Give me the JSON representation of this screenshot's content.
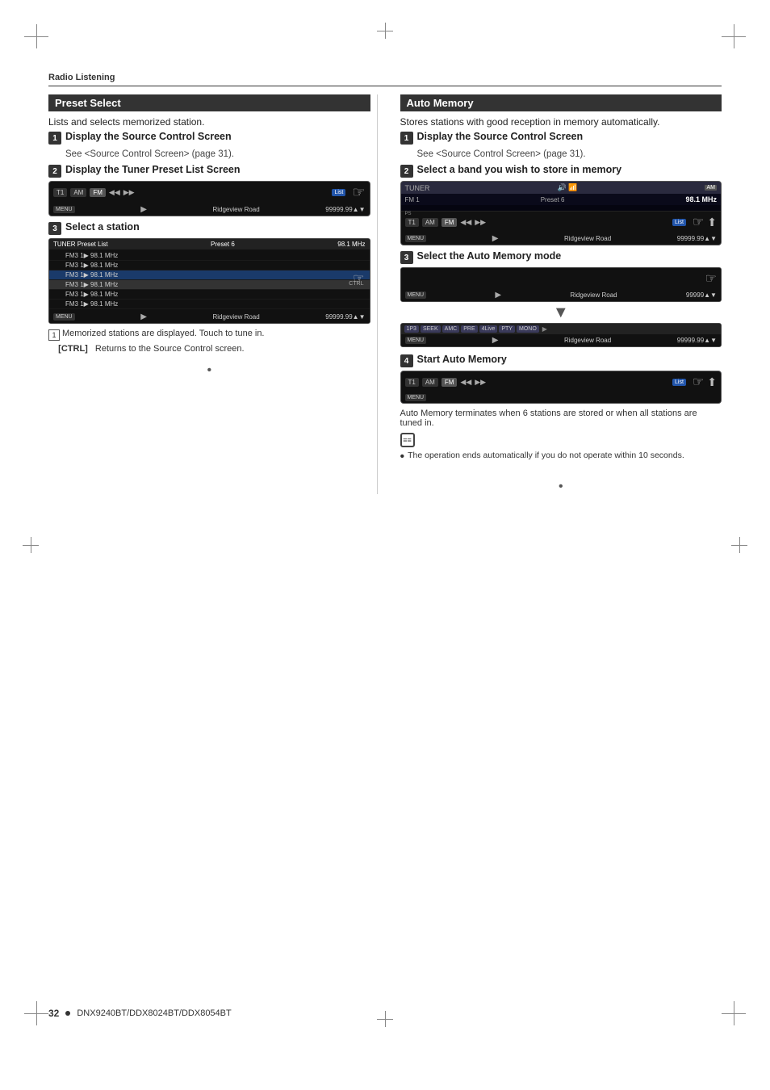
{
  "page": {
    "background": "#fff",
    "section_divider_label": "Radio Listening",
    "footer": {
      "page_num": "32",
      "dot": "●",
      "model": "DNX9240BT/DDX8024BT/DDX8054BT"
    }
  },
  "preset_select": {
    "title": "Preset Select",
    "description": "Lists and selects memorized station.",
    "step1": {
      "num": "1",
      "label": "Display the Source Control Screen",
      "sub": "See <Source Control Screen> (page 31)."
    },
    "step2": {
      "num": "2",
      "label": "Display the Tuner Preset List Screen"
    },
    "step3": {
      "num": "3",
      "label": "Select a station"
    },
    "preset_list_header": {
      "title": "TUNER Preset List",
      "preset": "Preset 6",
      "freq": "98.1 MHz"
    },
    "preset_items": [
      {
        "label": "FM3 1▶  98.1 MHz",
        "state": "normal"
      },
      {
        "label": "FM3 1▶  98.1 MHz",
        "state": "normal"
      },
      {
        "label": "FM3 1▶  98.1 MHz",
        "state": "highlighted"
      },
      {
        "label": "FM3 1▶  98.1 MHz",
        "state": "selected"
      },
      {
        "label": "FM3 1▶  98.1 MHz",
        "state": "normal"
      },
      {
        "label": "FM3 1▶  98.1 MHz",
        "state": "normal"
      }
    ],
    "bottom_bar": {
      "menu": "MENU",
      "road": "Ridgeview Road",
      "num": "99999.99▲▼"
    },
    "note1": {
      "num": "1",
      "text": "Memorized stations are displayed. Touch to tune in."
    },
    "ctrl_note": {
      "label": "[CTRL]",
      "text": "Returns to the Source Control screen."
    },
    "screen_topbar": {
      "left": "T1   AM   FM",
      "preset": "Preset 6",
      "freq": "98.1 MHz"
    },
    "screen_controls": {
      "t1": "T1",
      "am": "AM",
      "fm": "FM",
      "prev": "◀◀",
      "next": "▶▶",
      "list": "List"
    }
  },
  "auto_memory": {
    "title": "Auto Memory",
    "description": "Stores stations with good reception in memory automatically.",
    "step1": {
      "num": "1",
      "label": "Display the Source Control Screen",
      "sub": "See <Source Control Screen> (page 31)."
    },
    "step2": {
      "num": "2",
      "label": "Select a band you wish to store in memory"
    },
    "step3": {
      "num": "3",
      "label": "Select the Auto Memory mode"
    },
    "step4": {
      "num": "4",
      "label": "Start Auto Memory"
    },
    "tuner_screen": {
      "label": "TUNER",
      "fm": "FM  1",
      "preset": "Preset 6",
      "freq": "98.1 MHz"
    },
    "bottom_bar": {
      "menu": "MENU",
      "road": "Ridgeview Road",
      "num": "99999.99▲▼"
    },
    "seek_buttons": [
      "1P3",
      "SEEK",
      "AMC",
      "PRE",
      "4Live",
      "PTY",
      "MONO"
    ],
    "auto_memory_note": "Auto Memory terminates when 6 stations are stored or when all stations are tuned in.",
    "bullet_note": "The operation ends automatically if you do not operate within 10 seconds."
  }
}
